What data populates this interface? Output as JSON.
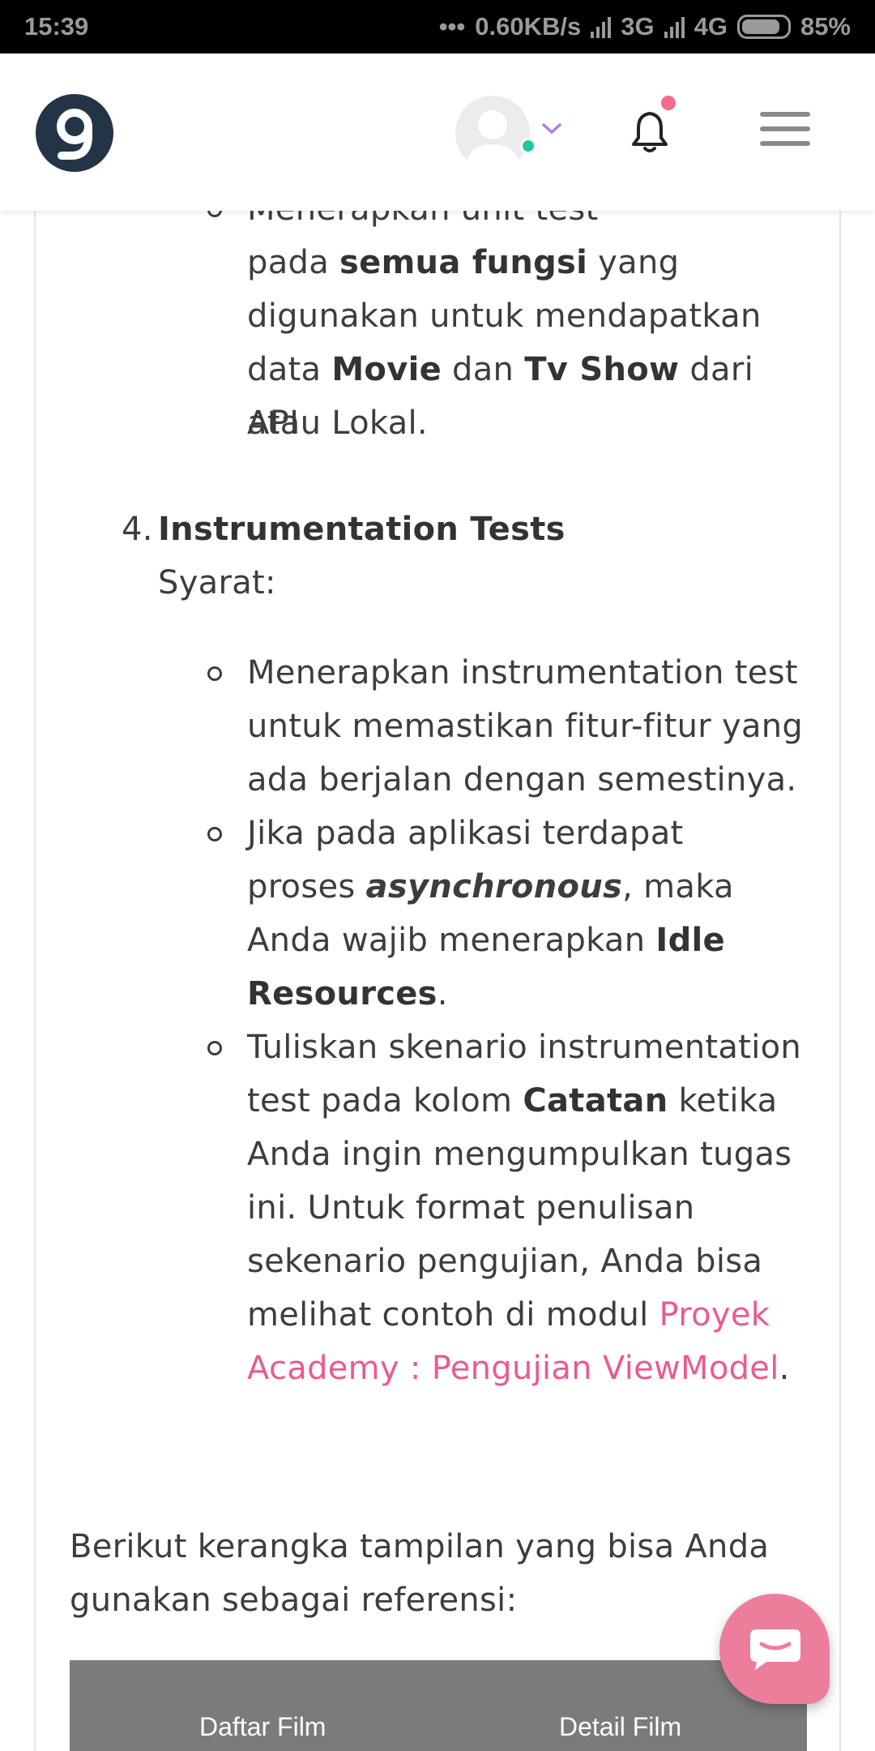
{
  "status_bar": {
    "time": "15:39",
    "network_speed": "0.60KB/s",
    "net1": "3G",
    "net2": "4G",
    "battery": "85%"
  },
  "header": {
    "logo_letter": "9",
    "icons": [
      "logo-icon",
      "avatar-icon",
      "chevron-down-icon",
      "bell-icon",
      "hamburger-menu-icon"
    ],
    "notification_dot_color": "#f06b8d",
    "online_dot_color": "#1fc9a6"
  },
  "content": {
    "bullet_top": {
      "partial_line": "Menerapkan unit test",
      "l2_pre": "pada ",
      "l2_bold": "semua fungsi",
      "l2_post": " yang",
      "l3": "digunakan untuk mendapatkan",
      "l4_pre": "data ",
      "l4_bold1": "Movie",
      "l4_mid": " dan ",
      "l4_bold2": "Tv Show",
      "l4_post": " dari API",
      "l5": "atau Lokal."
    },
    "section4": {
      "number": "4.",
      "title": "Instrumentation Tests",
      "syarat": "Syarat:"
    },
    "b1": {
      "l1": "Menerapkan instrumentation test",
      "l2": "untuk memastikan fitur-fitur yang",
      "l3": "ada berjalan dengan semestinya."
    },
    "b2": {
      "l1": "Jika pada aplikasi terdapat",
      "l2_pre": "proses ",
      "l2_em": "asynchronous",
      "l2_post": ", maka",
      "l3_pre": "Anda wajib menerapkan ",
      "l3_bold": "Idle",
      "l4_bold": "Resources",
      "l4_post": "."
    },
    "b3": {
      "l1": "Tuliskan skenario instrumentation",
      "l2_pre": "test pada kolom ",
      "l2_bold": "Catatan",
      "l2_post": " ketika",
      "l3": "Anda ingin mengumpulkan tugas",
      "l4": "ini. Untuk format penulisan",
      "l5": "sekenario pengujian, Anda bisa",
      "l6_pre": "melihat contoh di modul ",
      "l6_link": "Proyek",
      "l7_link": "Academy : Pengujian ViewModel",
      "l7_post": "."
    },
    "reference": {
      "l1": "Berikut kerangka tampilan yang bisa Anda",
      "l2": "gunakan sebagai referensi:"
    },
    "table": {
      "col1": "Daftar Film",
      "col2": "Detail Film"
    },
    "link_color": "#ea5b8e"
  },
  "chat_fab": {
    "icon": "chat-bubble-icon",
    "color": "#ec7e9c"
  }
}
